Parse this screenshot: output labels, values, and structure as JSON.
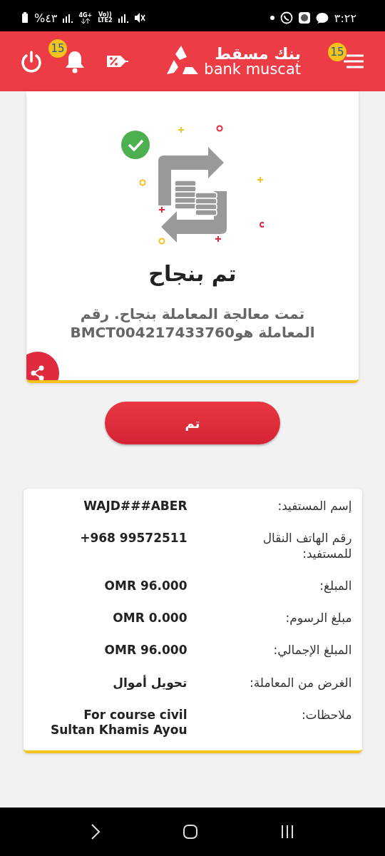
{
  "status_bar": {
    "battery": "%٤٣",
    "network": "4G+",
    "volte": "Vo))",
    "lte": "LTE2",
    "time": "٣:٢٢"
  },
  "header": {
    "logo_ar": "بنك مسقط",
    "logo_en": "bank muscat",
    "menu_badge": "15",
    "notifications_badge": "15"
  },
  "result": {
    "title": "تم بنجاح",
    "message": "تمت معالجة المعاملة بنجاح. رقم المعاملة هوBMCT004217433760"
  },
  "done_button": "تم",
  "details": [
    {
      "label": "إسم المستفيد:",
      "value": "WAJD###ABER"
    },
    {
      "label": "رقم الهاتف النقال للمستفيد:",
      "value": "+968 99572511"
    },
    {
      "label": "المبلغ:",
      "value": "OMR 96.000"
    },
    {
      "label": "مبلغ الرسوم:",
      "value": "OMR 0.000"
    },
    {
      "label": "المبلغ الإجمالي:",
      "value": "OMR 96.000"
    },
    {
      "label": "الغرض من المعاملة:",
      "value": "تحويل أموال"
    },
    {
      "label": "ملاحظات:",
      "value": "For course civil Sultan Khamis Ayou"
    }
  ]
}
